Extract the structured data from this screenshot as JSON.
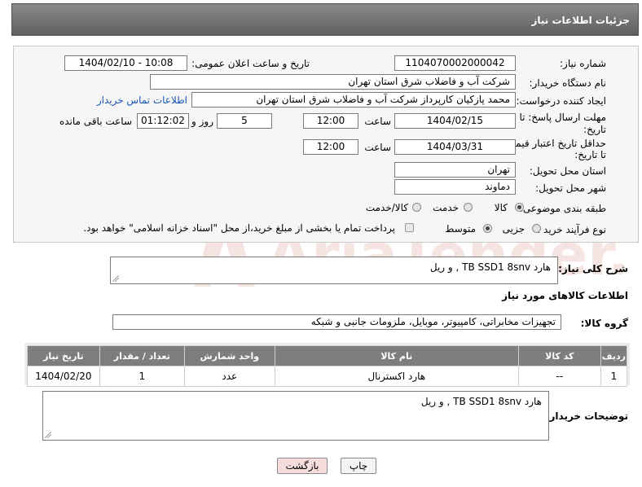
{
  "header": {
    "title": "جزئیات اطلاعات نیاز"
  },
  "form": {
    "need_number_label": "شماره نیاز:",
    "need_number": "1104070002000042",
    "announce_label": "تاریخ و ساعت اعلان عمومی:",
    "announce_value": "1404/02/10 - 10:08",
    "buyer_org_label": "نام دستگاه خریدار:",
    "buyer_org": "شرکت آب و فاضلاب شرق استان تهران",
    "creator_label": "ایجاد کننده درخواست:",
    "creator": "محمد پازکیان کارپرداز شرکت آب و فاضلاب شرق استان تهران",
    "contact_link": "اطلاعات تماس خریدار",
    "deadline_label_1": "مهلت ارسال پاسخ: تا",
    "deadline_label_2": "تاریخ:",
    "deadline_date": "1404/02/15",
    "time_label": "ساعت",
    "deadline_time": "12:00",
    "days_value": "5",
    "days_label": "روز و",
    "remaining_value": "01:12:02",
    "remaining_label": "ساعت باقی مانده",
    "validity_label_1": "حداقل تاریخ اعتبار قیمت:",
    "validity_label_2": "تا تاریخ:",
    "validity_date": "1404/03/31",
    "validity_time": "12:00",
    "province_label": "استان محل تحویل:",
    "province": "تهران",
    "city_label": "شهر محل تحویل:",
    "city": "دماوند",
    "category_label": "طبقه بندی موضوعی:",
    "category_options": [
      "کالا",
      "خدمت",
      "کالا/خدمت"
    ],
    "process_label": "نوع فرآیند خرید :",
    "process_options": [
      "جزیی",
      "متوسط"
    ],
    "payment_note": "پرداخت تمام یا بخشی از مبلغ خرید،از محل \"اسناد خزانه اسلامی\" خواهد بود."
  },
  "summary": {
    "label": "شرح کلی نیاز:",
    "value": "هارد TB SSD1 8snv , و ریل"
  },
  "goods": {
    "section_title": "اطلاعات کالاهای مورد نیاز",
    "group_label": "گروه کالا:",
    "group_value": "تجهیزات مخابراتی، کامپیوتر، موبایل، ملزومات جانبی و شبکه"
  },
  "table": {
    "headers": [
      "ردیف",
      "کد کالا",
      "نام کالا",
      "واحد شمارش",
      "تعداد / مقدار",
      "تاریخ نیاز"
    ],
    "rows": [
      [
        "1",
        "--",
        "هارد اکسترنال",
        "عدد",
        "1",
        "1404/02/20"
      ]
    ]
  },
  "buyer_notes": {
    "label": "توضیحات خریدار:",
    "value": "هارد TB SSD1 8snv , و ریل"
  },
  "buttons": {
    "print": "چاپ",
    "back": "بازگشت"
  },
  "watermark": {
    "text": "AriaTender.neT"
  },
  "colors": {
    "header_bg": "#6f6f6f",
    "link": "#1a56b8",
    "back_button_bg": "#f7dede",
    "watermark": "#c0392b"
  }
}
